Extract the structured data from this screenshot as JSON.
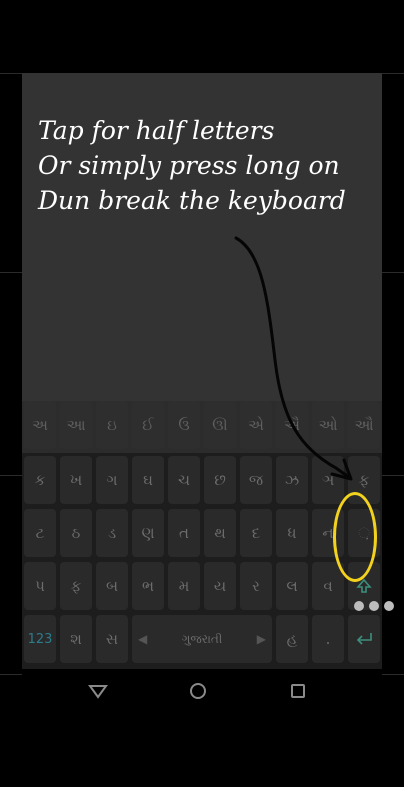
{
  "overlay": {
    "lines": [
      "Tap for half letters",
      "Or simply press long on",
      "Dun break the keyboard"
    ]
  },
  "keyboard": {
    "row1": [
      "અ",
      "આ",
      "ઇ",
      "ઈ",
      "ઉ",
      "ઊ",
      "એ",
      "ઐ",
      "ઓ",
      "ઔ"
    ],
    "row2": [
      "ક",
      "ખ",
      "ગ",
      "ઘ",
      "ચ",
      "છ",
      "જ",
      "ઝ",
      "ઞ",
      "ફ"
    ],
    "row3": [
      "ટ",
      "ઠ",
      "ડ",
      "ણ",
      "ત",
      "થ",
      "દ",
      "ધ",
      "ન",
      "઼"
    ],
    "row4": [
      "પ",
      "ફ",
      "બ",
      "ભ",
      "મ",
      "ય",
      "ર",
      "લ",
      "વ"
    ],
    "bottom": {
      "numbers_label": "123",
      "sha": "શ",
      "sa": "સ",
      "space_label": "ગુજરાતી",
      "ha": "હ",
      "period": "."
    }
  },
  "colors": {
    "highlight": "#f2d21e"
  },
  "icons": {
    "back": "triangle-down",
    "home": "circle",
    "recents": "square",
    "more": "three-dots",
    "enter": "enter-arrow",
    "shift": "shift-arrow"
  }
}
